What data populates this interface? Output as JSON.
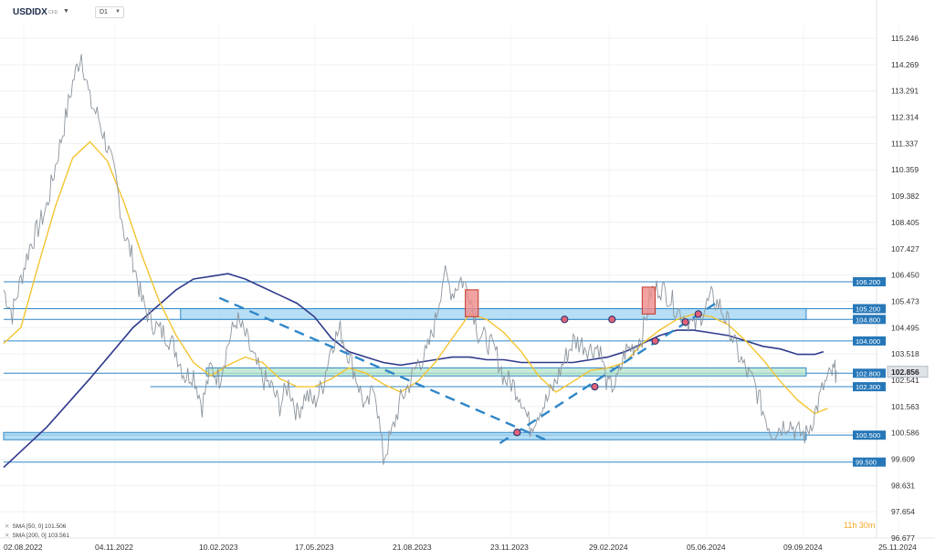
{
  "header": {
    "symbol": "USDIDX",
    "type": "CFD",
    "timeframe": "D1"
  },
  "legend": [
    {
      "label": "SMA [50, 0]",
      "value": "101.506"
    },
    {
      "label": "SMA [200, 0]",
      "value": "103.561"
    }
  ],
  "timer": "11h 30m",
  "colors": {
    "up": "#2fa6e0",
    "price_line": "#9aa4ad",
    "sma50": "#f4c430",
    "sma200": "#303a8c",
    "zone_blue": "#9fd3f0",
    "zone_green": "#b6e4c9",
    "label_blue": "#2677b8",
    "supply": "#f08b8b"
  },
  "chart_data": {
    "type": "line",
    "title": "USDIDX",
    "y_ticks": [
      "115.246",
      "114.269",
      "113.291",
      "112.314",
      "111.337",
      "110.359",
      "109.382",
      "108.405",
      "107.427",
      "106.450",
      "105.473",
      "104.495",
      "103.518",
      "102.541",
      "101.563",
      "100.586",
      "99.609",
      "98.631",
      "97.654",
      "96.677"
    ],
    "x_ticks": [
      "02.08.2022",
      "04.11.2022",
      "10.02.2023",
      "17.05.2023",
      "21.08.2023",
      "23.11.2023",
      "29.02.2024",
      "05.06.2024",
      "09.09.2024",
      "25.11.2024"
    ],
    "ylim": [
      96.677,
      115.246
    ],
    "current_price": "102.856",
    "price_path": [
      [
        0,
        105.9
      ],
      [
        2,
        105.0
      ],
      [
        4,
        106.3
      ],
      [
        6,
        107.5
      ],
      [
        8,
        108.2
      ],
      [
        10,
        109.0
      ],
      [
        12,
        110.5
      ],
      [
        14,
        112.0
      ],
      [
        16,
        113.6
      ],
      [
        18,
        114.7
      ],
      [
        20,
        112.9
      ],
      [
        22,
        112.3
      ],
      [
        24,
        111.2
      ],
      [
        26,
        110.0
      ],
      [
        28,
        108.0
      ],
      [
        30,
        107.0
      ],
      [
        32,
        105.5
      ],
      [
        34,
        104.8
      ],
      [
        36,
        104.4
      ],
      [
        38,
        104.2
      ],
      [
        40,
        103.6
      ],
      [
        42,
        102.7
      ],
      [
        44,
        102.8
      ],
      [
        46,
        101.6
      ],
      [
        48,
        103.0
      ],
      [
        50,
        102.6
      ],
      [
        52,
        103.9
      ],
      [
        54,
        104.8
      ],
      [
        56,
        104.2
      ],
      [
        58,
        103.3
      ],
      [
        60,
        102.6
      ],
      [
        62,
        102.3
      ],
      [
        64,
        101.6
      ],
      [
        66,
        102.4
      ],
      [
        68,
        101.3
      ],
      [
        70,
        102.0
      ],
      [
        72,
        101.7
      ],
      [
        74,
        102.4
      ],
      [
        76,
        103.9
      ],
      [
        78,
        104.4
      ],
      [
        80,
        103.5
      ],
      [
        82,
        102.5
      ],
      [
        84,
        101.4
      ],
      [
        86,
        102.4
      ],
      [
        88,
        99.6
      ],
      [
        90,
        100.6
      ],
      [
        92,
        101.8
      ],
      [
        94,
        102.4
      ],
      [
        96,
        103.2
      ],
      [
        98,
        103.5
      ],
      [
        100,
        104.7
      ],
      [
        102,
        106.5
      ],
      [
        104,
        105.8
      ],
      [
        106,
        106.3
      ],
      [
        108,
        105.8
      ],
      [
        110,
        104.3
      ],
      [
        112,
        104.0
      ],
      [
        114,
        103.6
      ],
      [
        116,
        102.6
      ],
      [
        118,
        102.4
      ],
      [
        120,
        101.9
      ],
      [
        122,
        100.8
      ],
      [
        124,
        101.4
      ],
      [
        126,
        101.8
      ],
      [
        128,
        102.5
      ],
      [
        130,
        103.3
      ],
      [
        132,
        104.0
      ],
      [
        134,
        103.9
      ],
      [
        136,
        103.7
      ],
      [
        138,
        103.8
      ],
      [
        140,
        102.3
      ],
      [
        142,
        102.4
      ],
      [
        144,
        103.6
      ],
      [
        146,
        103.8
      ],
      [
        148,
        104.2
      ],
      [
        150,
        105.8
      ],
      [
        152,
        106.0
      ],
      [
        154,
        105.7
      ],
      [
        156,
        105.2
      ],
      [
        158,
        104.9
      ],
      [
        160,
        104.5
      ],
      [
        162,
        105.1
      ],
      [
        164,
        105.6
      ],
      [
        166,
        105.3
      ],
      [
        168,
        104.6
      ],
      [
        170,
        103.6
      ],
      [
        172,
        102.9
      ],
      [
        174,
        102.4
      ],
      [
        176,
        101.4
      ],
      [
        178,
        100.6
      ],
      [
        180,
        100.8
      ],
      [
        182,
        101.0
      ],
      [
        184,
        100.6
      ],
      [
        186,
        100.5
      ],
      [
        188,
        101.3
      ],
      [
        190,
        102.3
      ],
      [
        192,
        102.8
      ],
      [
        193,
        102.9
      ]
    ],
    "sma50_path": [
      [
        0,
        103.9
      ],
      [
        4,
        104.5
      ],
      [
        8,
        106.8
      ],
      [
        12,
        109.0
      ],
      [
        16,
        110.8
      ],
      [
        20,
        111.4
      ],
      [
        24,
        110.7
      ],
      [
        28,
        109.1
      ],
      [
        32,
        107.2
      ],
      [
        36,
        105.5
      ],
      [
        40,
        104.2
      ],
      [
        44,
        103.2
      ],
      [
        48,
        102.7
      ],
      [
        52,
        103.1
      ],
      [
        56,
        103.4
      ],
      [
        60,
        103.2
      ],
      [
        64,
        102.6
      ],
      [
        68,
        102.3
      ],
      [
        72,
        102.3
      ],
      [
        76,
        102.6
      ],
      [
        80,
        103.0
      ],
      [
        84,
        102.8
      ],
      [
        88,
        102.4
      ],
      [
        92,
        102.1
      ],
      [
        96,
        102.5
      ],
      [
        100,
        103.2
      ],
      [
        104,
        104.1
      ],
      [
        108,
        105.0
      ],
      [
        112,
        104.8
      ],
      [
        116,
        104.3
      ],
      [
        120,
        103.6
      ],
      [
        124,
        102.7
      ],
      [
        128,
        102.1
      ],
      [
        132,
        102.5
      ],
      [
        136,
        102.9
      ],
      [
        140,
        103.0
      ],
      [
        144,
        103.2
      ],
      [
        148,
        103.9
      ],
      [
        152,
        104.4
      ],
      [
        156,
        104.8
      ],
      [
        160,
        105.0
      ],
      [
        164,
        104.9
      ],
      [
        168,
        104.6
      ],
      [
        172,
        104.0
      ],
      [
        176,
        103.3
      ],
      [
        180,
        102.5
      ],
      [
        184,
        101.8
      ],
      [
        188,
        101.3
      ],
      [
        191,
        101.5
      ]
    ],
    "sma200_path": [
      [
        0,
        99.3
      ],
      [
        10,
        100.8
      ],
      [
        20,
        102.6
      ],
      [
        30,
        104.5
      ],
      [
        40,
        105.9
      ],
      [
        44,
        106.3
      ],
      [
        48,
        106.4
      ],
      [
        52,
        106.5
      ],
      [
        56,
        106.3
      ],
      [
        60,
        106.0
      ],
      [
        64,
        105.7
      ],
      [
        68,
        105.4
      ],
      [
        72,
        104.9
      ],
      [
        76,
        104.1
      ],
      [
        80,
        103.6
      ],
      [
        84,
        103.4
      ],
      [
        88,
        103.2
      ],
      [
        92,
        103.1
      ],
      [
        96,
        103.2
      ],
      [
        100,
        103.3
      ],
      [
        104,
        103.4
      ],
      [
        108,
        103.4
      ],
      [
        112,
        103.3
      ],
      [
        116,
        103.3
      ],
      [
        120,
        103.2
      ],
      [
        124,
        103.2
      ],
      [
        128,
        103.2
      ],
      [
        132,
        103.2
      ],
      [
        136,
        103.3
      ],
      [
        140,
        103.4
      ],
      [
        144,
        103.6
      ],
      [
        148,
        103.9
      ],
      [
        152,
        104.2
      ],
      [
        156,
        104.4
      ],
      [
        160,
        104.4
      ],
      [
        164,
        104.3
      ],
      [
        168,
        104.2
      ],
      [
        172,
        104.0
      ],
      [
        176,
        103.8
      ],
      [
        180,
        103.7
      ],
      [
        184,
        103.5
      ],
      [
        188,
        103.5
      ],
      [
        190,
        103.6
      ]
    ],
    "levels": [
      {
        "value": 106.2,
        "label": "106.200",
        "x_from": 0
      },
      {
        "value": 105.2,
        "label": "105.200",
        "x_from": 0
      },
      {
        "value": 104.8,
        "label": "104.800",
        "x_from": 0
      },
      {
        "value": 104.0,
        "label": "104.000",
        "x_from": 0
      },
      {
        "value": 102.8,
        "label": "102.800",
        "x_from": 0
      },
      {
        "value": 102.3,
        "label": "102.300",
        "x_from": 34
      },
      {
        "value": 100.5,
        "label": "100.500",
        "x_from": 0
      },
      {
        "value": 99.5,
        "label": "99.500",
        "x_from": 0
      }
    ],
    "zones": [
      {
        "from": 104.8,
        "to": 105.2,
        "x_from": 41,
        "x_to": 186,
        "color": "blue"
      },
      {
        "from": 102.7,
        "to": 103.0,
        "x_from": 47,
        "x_to": 186,
        "color": "green"
      },
      {
        "from": 100.4,
        "to": 100.6,
        "x_from": 0,
        "x_to": 186,
        "color": "blue"
      }
    ],
    "supply_boxes": [
      {
        "x_from": 107,
        "x_to": 110,
        "from": 104.9,
        "to": 105.9
      },
      {
        "x_from": 148,
        "x_to": 151,
        "from": 105.0,
        "to": 106.0
      }
    ],
    "trendlines": [
      [
        [
          50,
          105.6
        ],
        [
          126,
          100.3
        ]
      ],
      [
        [
          115,
          100.2
        ],
        [
          165,
          105.4
        ]
      ]
    ],
    "markers": [
      [
        119,
        100.6
      ],
      [
        130,
        104.8
      ],
      [
        137,
        102.3
      ],
      [
        141,
        104.8
      ],
      [
        151,
        104.0
      ],
      [
        158,
        104.7
      ],
      [
        161,
        105.0
      ]
    ]
  }
}
